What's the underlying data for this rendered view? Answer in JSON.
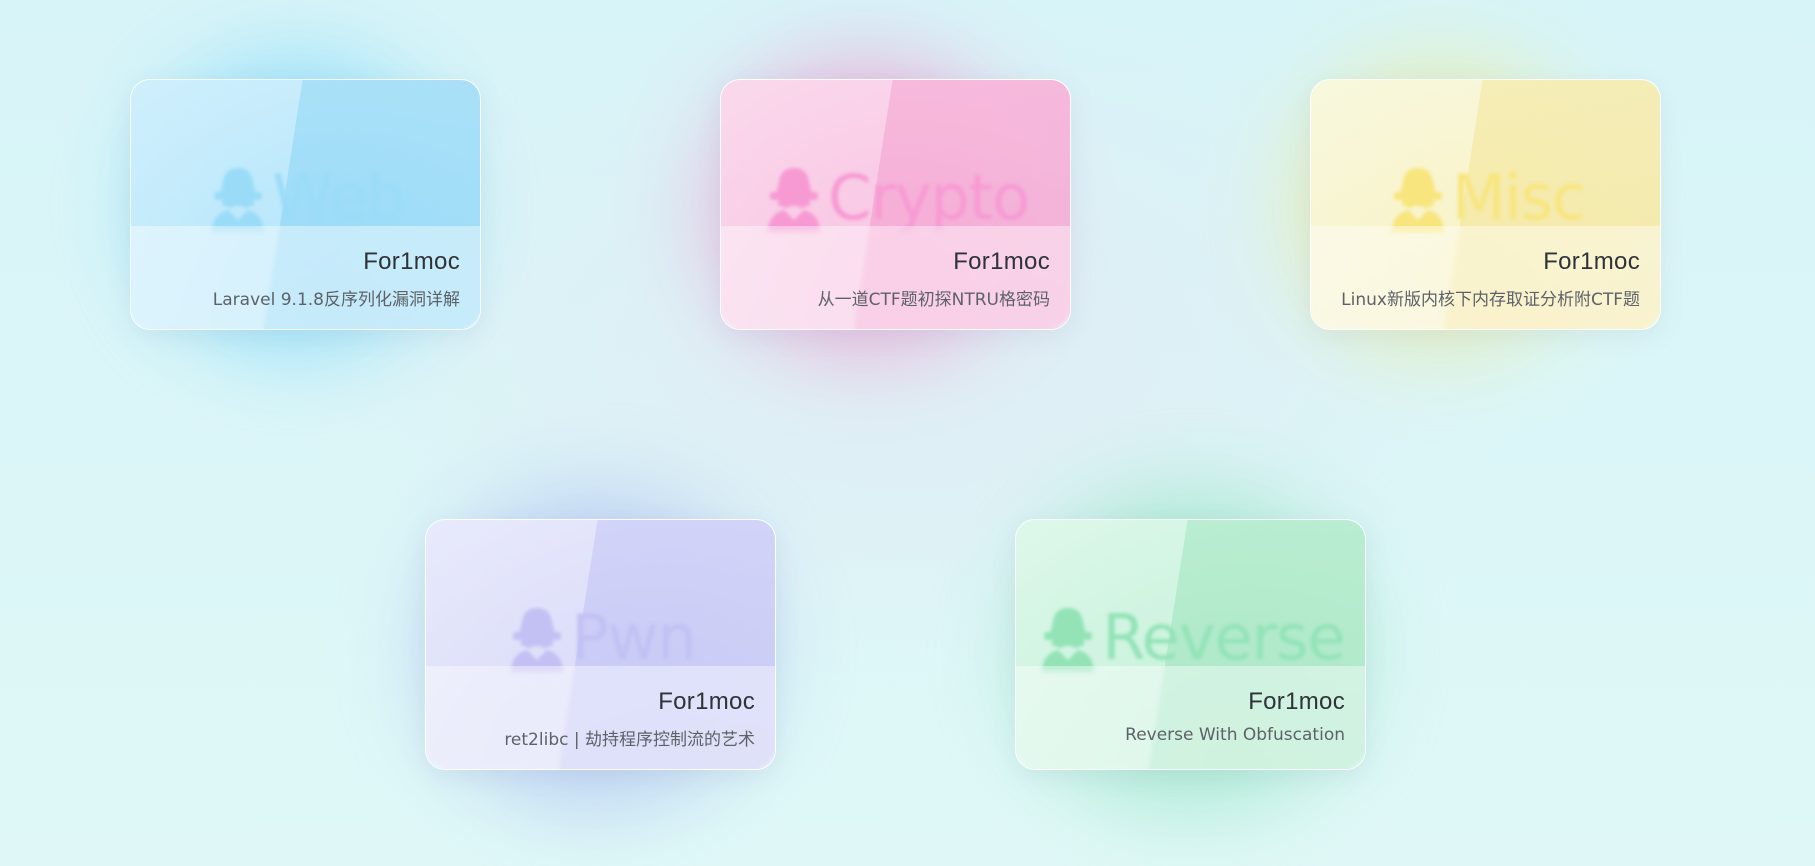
{
  "theme": {
    "background": "#daf6f7",
    "web": "#6fd1f6",
    "crypto": "#f27ec8",
    "misc": "#f5e66b",
    "pwn": "#9fb0f0",
    "reverse": "#7fe0b0"
  },
  "cards": [
    {
      "category": "Web",
      "icon": "spy-icon",
      "author": "For1moc",
      "title": "Laravel 9.1.8反序列化漏洞详解",
      "accent": "#6fd1f6"
    },
    {
      "category": "Crypto",
      "icon": "spy-icon",
      "author": "For1moc",
      "title": "从一道CTF题初探NTRU格密码",
      "accent": "#f27ec8"
    },
    {
      "category": "Misc",
      "icon": "spy-icon",
      "author": "For1moc",
      "title": "Linux新版内核下内存取证分析附CTF题",
      "accent": "#f5e66b"
    },
    {
      "category": "Pwn",
      "icon": "spy-icon",
      "author": "For1moc",
      "title": "ret2libc | 劫持程序控制流的艺术",
      "accent": "#9fb0f0"
    },
    {
      "category": "Reverse",
      "icon": "spy-icon",
      "author": "For1moc",
      "title": "Reverse With Obfuscation",
      "accent": "#7fe0b0"
    }
  ]
}
